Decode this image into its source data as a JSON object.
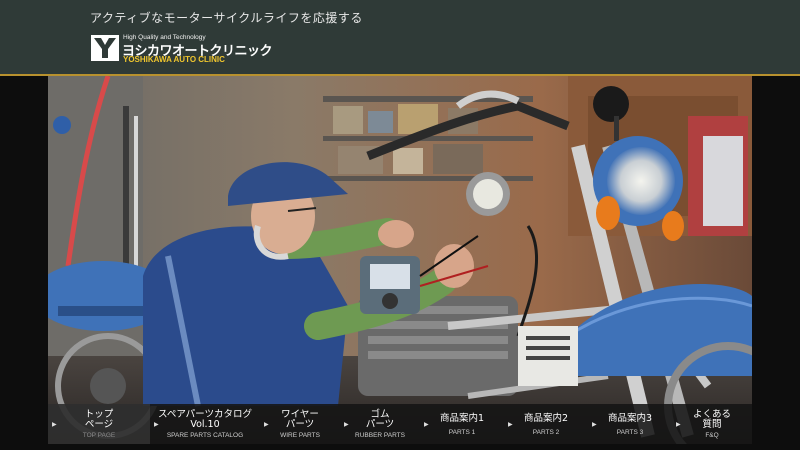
{
  "header": {
    "tagline": "アクティブなモーターサイクルライフを応援する",
    "logo_small": "High Quality and Technology",
    "logo_jp": "ヨシカワオートクリニック",
    "logo_en": "YOSHIKAWA AUTO CLINIC"
  },
  "nav": {
    "items": [
      {
        "jp": "トップ\nページ",
        "en": "TOP PAGE"
      },
      {
        "jp": "スペアパーツカタログ\nVol.10",
        "en": "SPARE PARTS CATALOG"
      },
      {
        "jp": "ワイヤー\nパーツ",
        "en": "WIRE PARTS"
      },
      {
        "jp": "ゴム\nパーツ",
        "en": "RUBBER PARTS"
      },
      {
        "jp": "商品案内1",
        "en": "PARTS 1"
      },
      {
        "jp": "商品案内2",
        "en": "PARTS 2"
      },
      {
        "jp": "商品案内3",
        "en": "PARTS 3"
      },
      {
        "jp": "よくある\n質問",
        "en": "F&Q"
      }
    ]
  },
  "colors": {
    "header_bg": "#2f3a37",
    "accent_gold": "#b8912e",
    "logo_yellow": "#f0c62e",
    "bike_blue": "#3f72b8"
  }
}
